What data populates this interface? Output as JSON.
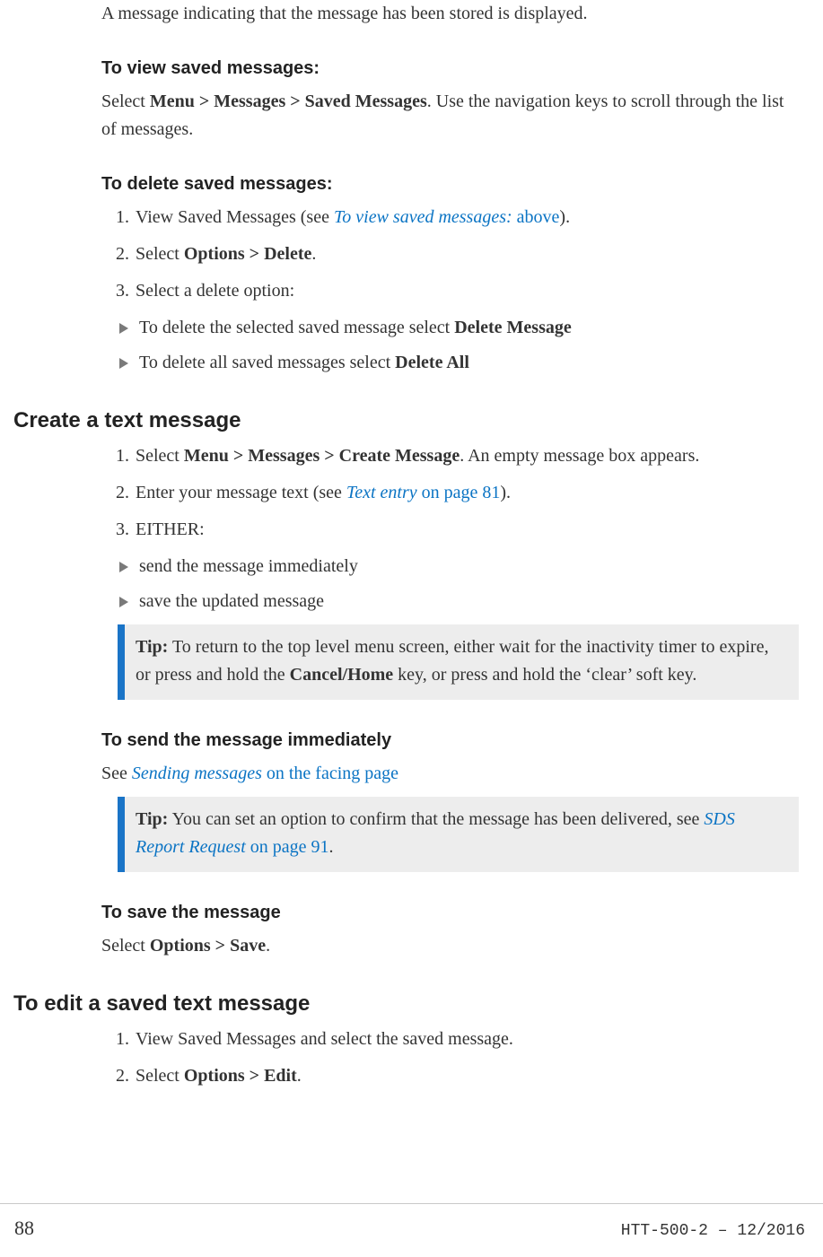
{
  "intro_para": "A message indicating that the message has been stored is displayed.",
  "view_heading": "To view saved messages:",
  "view_text_a": "Select ",
  "view_text_bold": "Menu > Messages > Saved Messages",
  "view_text_b": ". Use the navigation keys to scroll through the list of messages.",
  "delete_heading": "To delete saved messages:",
  "delete_item1_a": "View Saved Messages (see ",
  "delete_item1_link_i": "To view saved messages:",
  "delete_item1_link_n": " above",
  "delete_item1_b": ").",
  "delete_item2_a": "Select ",
  "delete_item2_bold": "Options > Delete",
  "delete_item2_b": ".",
  "delete_item3": "Select a delete option:",
  "delete_sub1_a": "To delete the selected saved message select ",
  "delete_sub1_bold": "Delete Message",
  "delete_sub2_a": "To delete all saved messages select ",
  "delete_sub2_bold": "Delete All",
  "create_heading": "Create a text message",
  "create_item1_a": "Select ",
  "create_item1_bold": "Menu > Messages > Create Message",
  "create_item1_b": ". An empty message box appears.",
  "create_item2_a": "Enter your message text (see ",
  "create_item2_link_i": "Text entry",
  "create_item2_link_n": " on page 81",
  "create_item2_b": ").",
  "create_item3": "EITHER:",
  "create_sub1": "send the message immediately",
  "create_sub2": "save the updated message",
  "tip1_label": "Tip:",
  "tip1_a": "  To return to the top level menu screen, either wait for the inactivity timer to expire, or press and hold the ",
  "tip1_bold": "Cancel/Home",
  "tip1_b": " key, or press and hold the ‘clear’ soft key.",
  "send_heading": "To send the message immediately",
  "send_text_a": "See ",
  "send_link_i": "Sending messages",
  "send_link_n": " on the facing page",
  "tip2_label": "Tip:",
  "tip2_a": "  You can set an option to confirm that the message has been delivered, see ",
  "tip2_link_i": "SDS Report Request",
  "tip2_link_n": " on page 91",
  "tip2_b": ".",
  "save_heading": "To save the message",
  "save_text_a": "Select ",
  "save_text_bold": "Options > Save",
  "save_text_b": ".",
  "edit_heading": "To edit a saved text message",
  "edit_item1": "View Saved Messages and select the saved message.",
  "edit_item2_a": "Select ",
  "edit_item2_bold": "Options > Edit",
  "edit_item2_b": ".",
  "page_number": "88",
  "doc_id": "HTT-500-2 – 12/2016"
}
